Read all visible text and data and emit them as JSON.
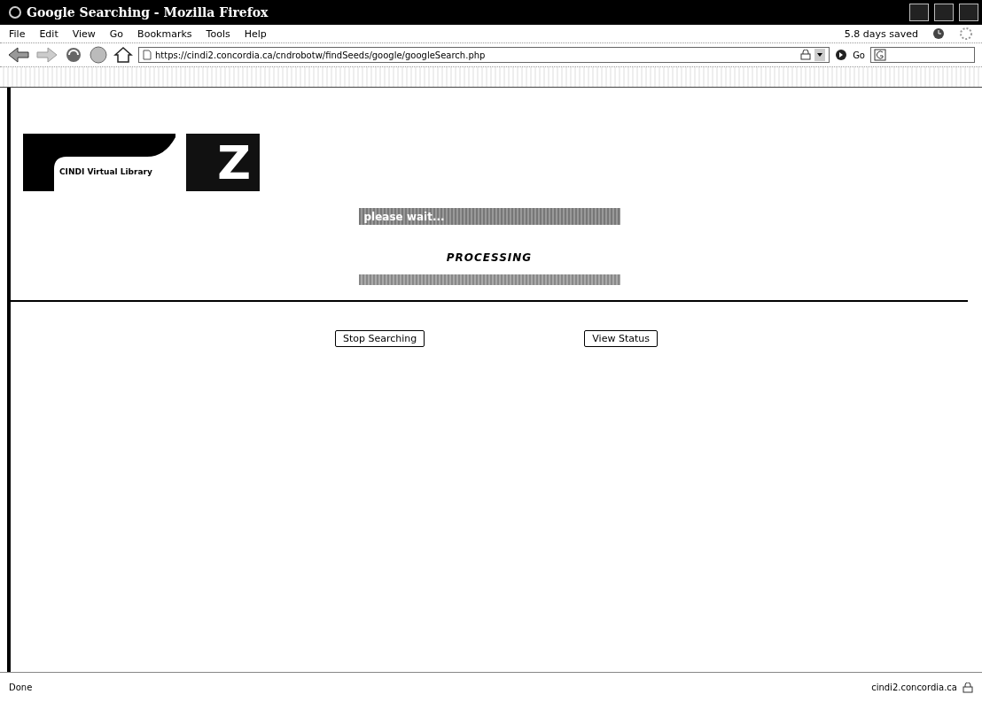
{
  "window": {
    "title": "Google Searching - Mozilla Firefox"
  },
  "menu": [
    "File",
    "Edit",
    "View",
    "Go",
    "Bookmarks",
    "Tools",
    "Help"
  ],
  "menu_status": "5.8 days saved",
  "address_bar": {
    "value": "https://cindi2.concordia.ca/cndrobotw/findSeeds/google/googleSearch.php"
  },
  "go_label": "Go",
  "logo": {
    "text": "CINDI Virtual Library",
    "mark": "Z"
  },
  "wait_banner": "please wait...",
  "processing": "PROCESSING",
  "buttons": [
    "Stop Searching",
    "View Status"
  ],
  "status_bar": {
    "text": "Done",
    "host": "cindi2.concordia.ca"
  }
}
